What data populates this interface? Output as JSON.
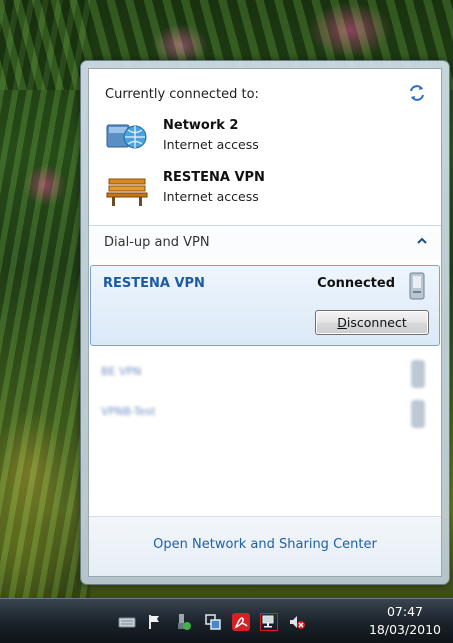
{
  "flyout": {
    "title": "Currently connected to:",
    "refresh_icon": "refresh-icon",
    "networks": [
      {
        "name": "Network  2",
        "status": "Internet access",
        "icon": "network-globe-icon"
      },
      {
        "name": "RESTENA VPN",
        "status": "Internet access",
        "icon": "vpn-bench-icon"
      }
    ],
    "section": {
      "label": "Dial-up and VPN",
      "chevron": "chevron-up-icon"
    },
    "active_vpn": {
      "name": "RESTENA VPN",
      "status": "Connected",
      "disconnect_label": "Disconnect"
    },
    "other_vpns": [
      {
        "name": "BE VPN"
      },
      {
        "name": "VPNB-Test"
      }
    ],
    "footer_link": "Open Network and Sharing Center"
  },
  "taskbar": {
    "time": "07:47",
    "date": "18/03/2010",
    "tray_icons": [
      "keyboard-icon",
      "flag-icon",
      "usb-icon",
      "network-sync-icon",
      "acrobat-icon",
      "network-monitor-icon",
      "volume-muted-icon"
    ]
  },
  "colors": {
    "link": "#1f5fa8",
    "vpn_name": "#1c5aa3",
    "selection_border": "#7da2ce"
  }
}
